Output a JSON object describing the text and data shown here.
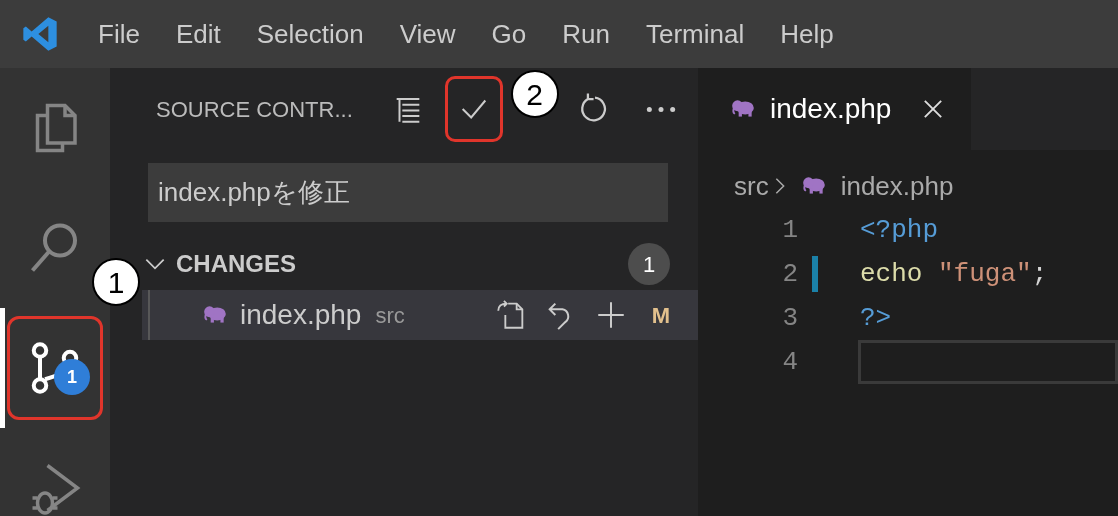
{
  "menu": [
    "File",
    "Edit",
    "Selection",
    "View",
    "Go",
    "Run",
    "Terminal",
    "Help"
  ],
  "activity_bar": [
    {
      "kind": "explorer",
      "selected": false,
      "highlighted": false
    },
    {
      "kind": "search",
      "selected": false,
      "highlighted": false
    },
    {
      "kind": "scm",
      "selected": true,
      "badge": "1",
      "highlighted": true,
      "callout": "1"
    },
    {
      "kind": "debug",
      "selected": false,
      "highlighted": false
    }
  ],
  "sidebar": {
    "title": "SOURCE CONTR...",
    "actions": [
      {
        "kind": "tree",
        "highlighted": false
      },
      {
        "kind": "commit",
        "highlighted": true,
        "callout": "2"
      },
      {
        "kind": "refresh",
        "highlighted": false
      },
      {
        "kind": "more",
        "highlighted": false
      }
    ],
    "message": {
      "value": "index.phpを修正"
    },
    "changes": {
      "title": "CHANGES",
      "expanded": true,
      "count": "1",
      "files": [
        {
          "name": "index.php",
          "folder": "src",
          "status": "M",
          "selected": true
        }
      ]
    }
  },
  "editor": {
    "tabs": [
      {
        "label": "index.php",
        "selected": true
      }
    ],
    "breadcrumb": [
      "src",
      "index.php"
    ],
    "lines": [
      {
        "number": "1",
        "modified": false,
        "current": false,
        "tokens": [
          {
            "kind": "tag",
            "text": "<?php"
          }
        ]
      },
      {
        "number": "2",
        "modified": true,
        "current": false,
        "tokens": [
          {
            "kind": "keyword",
            "text": "echo "
          },
          {
            "kind": "string",
            "text": "\"fuga\""
          },
          {
            "kind": "plain",
            "text": ";"
          }
        ]
      },
      {
        "number": "3",
        "modified": false,
        "current": false,
        "tokens": [
          {
            "kind": "tag",
            "text": "?>"
          }
        ]
      },
      {
        "number": "4",
        "modified": false,
        "current": true
      }
    ]
  }
}
